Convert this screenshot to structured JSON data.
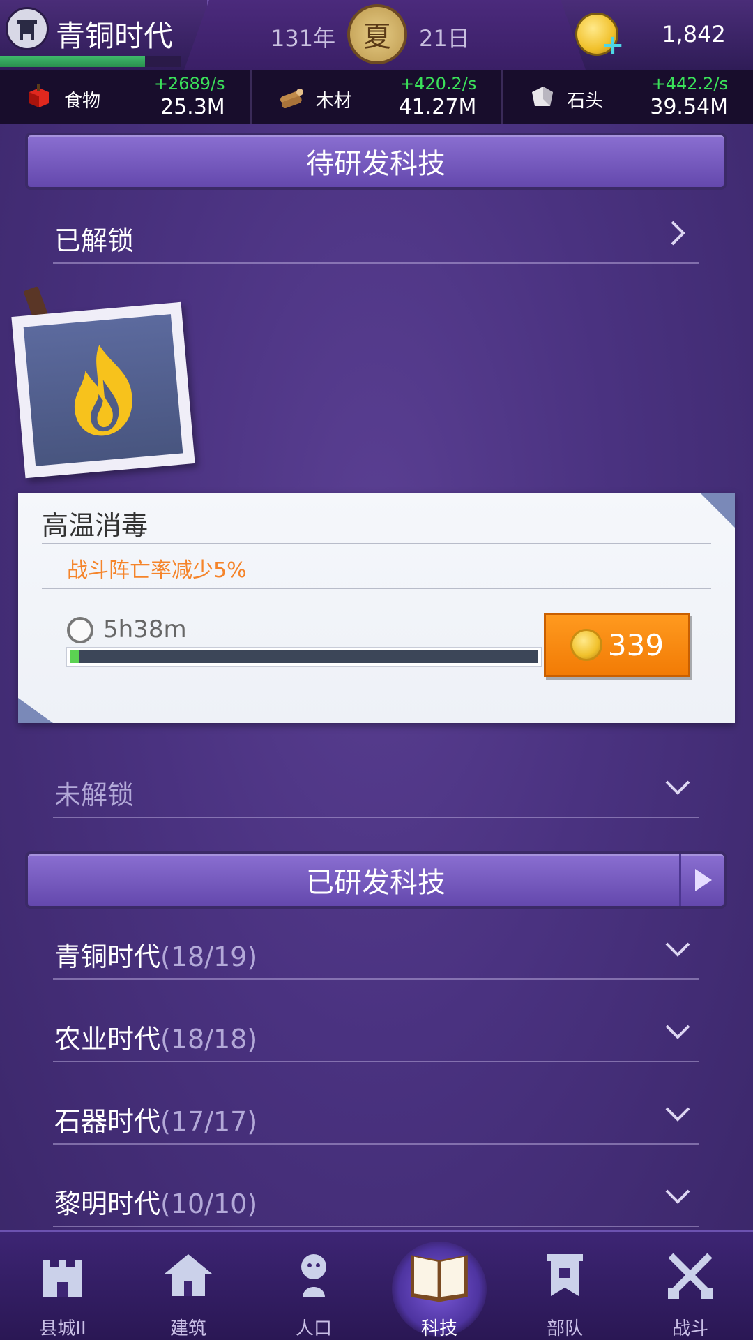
{
  "header": {
    "era_title": "青铜时代",
    "era_progress": 0.8,
    "year": "131年",
    "season": "夏",
    "day": "21日",
    "coins": "1,842"
  },
  "resources": [
    {
      "name": "食物",
      "rate": "+2689/s",
      "amount": "25.3M",
      "icon": "food-icon"
    },
    {
      "name": "木材",
      "rate": "+420.2/s",
      "amount": "41.27M",
      "icon": "wood-icon"
    },
    {
      "name": "石头",
      "rate": "+442.2/s",
      "amount": "39.54M",
      "icon": "stone-icon"
    }
  ],
  "pending": {
    "title": "待研发科技",
    "unlocked_label": "已解锁",
    "locked_label": "未解锁"
  },
  "tech_card": {
    "name": "高温消毒",
    "effect": "战斗阵亡率减少5%",
    "time_left": "5h38m",
    "progress": 0.02,
    "cost": "339"
  },
  "researched": {
    "title": "已研发科技",
    "eras": [
      {
        "name": "青铜时代",
        "count": "(18/19)"
      },
      {
        "name": "农业时代",
        "count": "(18/18)"
      },
      {
        "name": "石器时代",
        "count": "(17/17)"
      },
      {
        "name": "黎明时代",
        "count": "(10/10)"
      }
    ]
  },
  "nav": [
    {
      "label": "县城II",
      "icon": "castle-icon"
    },
    {
      "label": "建筑",
      "icon": "house-icon"
    },
    {
      "label": "人口",
      "icon": "person-icon"
    },
    {
      "label": "科技",
      "icon": "book-icon",
      "active": true
    },
    {
      "label": "部队",
      "icon": "banner-icon"
    },
    {
      "label": "战斗",
      "icon": "crossed-swords-icon"
    }
  ],
  "colors": {
    "accent_orange": "#f27b05",
    "rate_green": "#3be15a",
    "header_purple": "#6448ad"
  }
}
